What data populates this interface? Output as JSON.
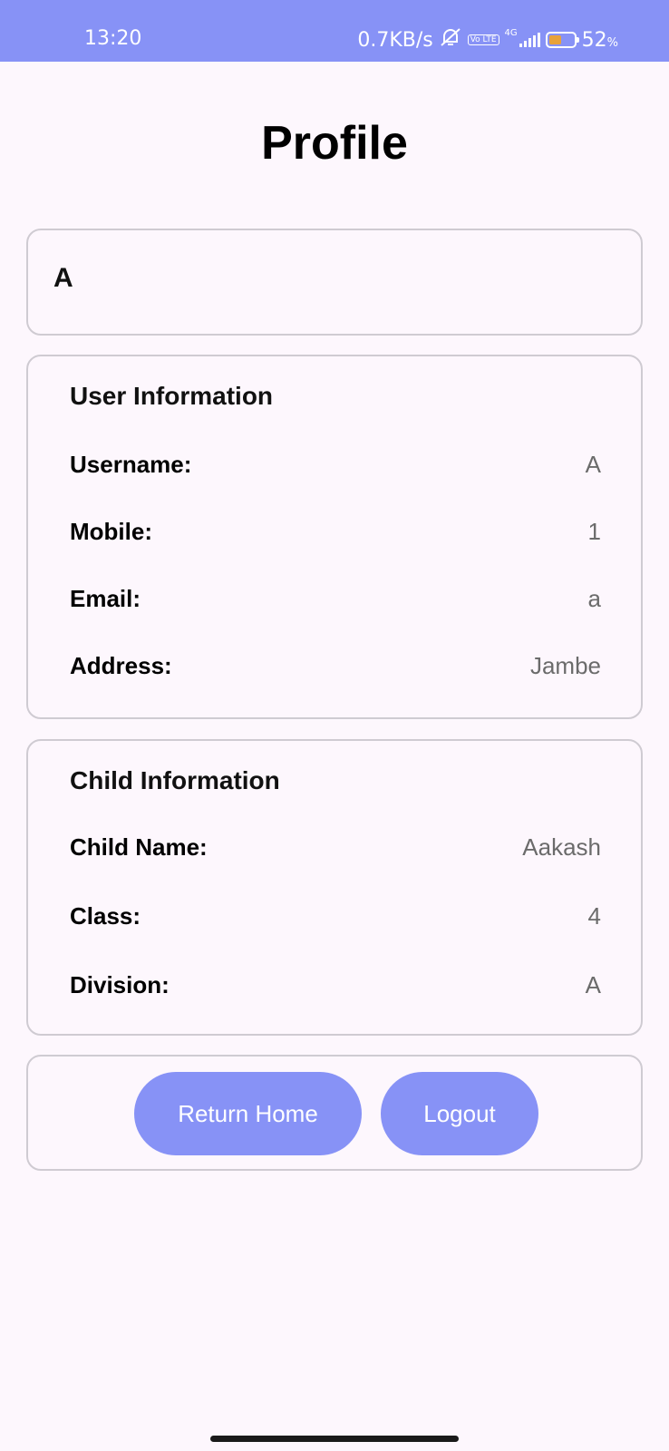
{
  "status_bar": {
    "time": "13:20",
    "network_speed": "0.7KB/s",
    "volte": "Vo LTE",
    "network_type": "4G",
    "battery_percent": "52",
    "battery_level": 0.52,
    "battery_color": "#e8a23a"
  },
  "page": {
    "title": "Profile"
  },
  "profile_name": "A",
  "user_info": {
    "title": "User Information",
    "rows": [
      {
        "label": "Username:",
        "value": "A"
      },
      {
        "label": "Mobile:",
        "value": "1"
      },
      {
        "label": "Email:",
        "value": "a"
      },
      {
        "label": "Address:",
        "value": "Jambe"
      }
    ]
  },
  "child_info": {
    "title": "Child Information",
    "rows": [
      {
        "label": "Child Name:",
        "value": "Aakash"
      },
      {
        "label": "Class:",
        "value": "4"
      },
      {
        "label": "Division:",
        "value": "A"
      }
    ]
  },
  "actions": {
    "return_home_label": "Return Home",
    "logout_label": "Logout"
  },
  "colors": {
    "accent": "#8792f6",
    "background": "#fdf7fd",
    "card_border": "#cfcbd2"
  }
}
